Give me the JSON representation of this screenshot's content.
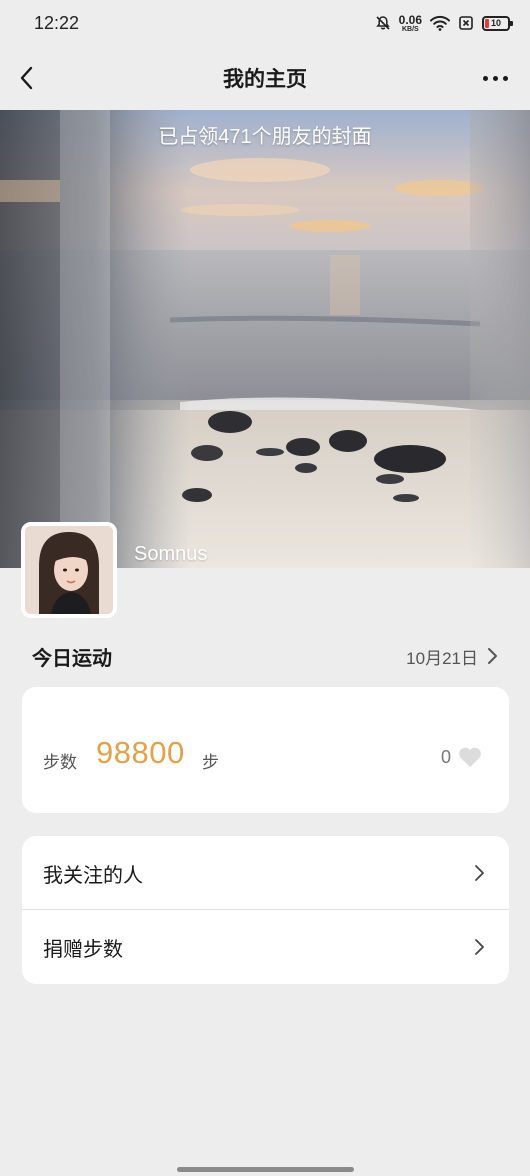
{
  "status_bar": {
    "time": "12:22",
    "net_speed_value": "0.06",
    "net_speed_unit": "KB/S",
    "battery": "10",
    "icons": [
      "bell-mute-icon",
      "wifi-icon",
      "sim-off-icon",
      "battery-icon"
    ]
  },
  "navbar": {
    "title": "我的主页",
    "back_icon": "chevron-left-icon",
    "more_icon": "more-dots-icon"
  },
  "cover": {
    "caption": "已占领471个朋友的封面",
    "username": "Somnus"
  },
  "sport": {
    "section_label": "今日运动",
    "date": "10月21日",
    "steps_label": "步数",
    "steps_value": "98800",
    "steps_unit": "步",
    "like_count": "0",
    "accent_color": "#e2a24a"
  },
  "menu": {
    "items": [
      {
        "label": "我关注的人"
      },
      {
        "label": "捐赠步数"
      }
    ]
  }
}
